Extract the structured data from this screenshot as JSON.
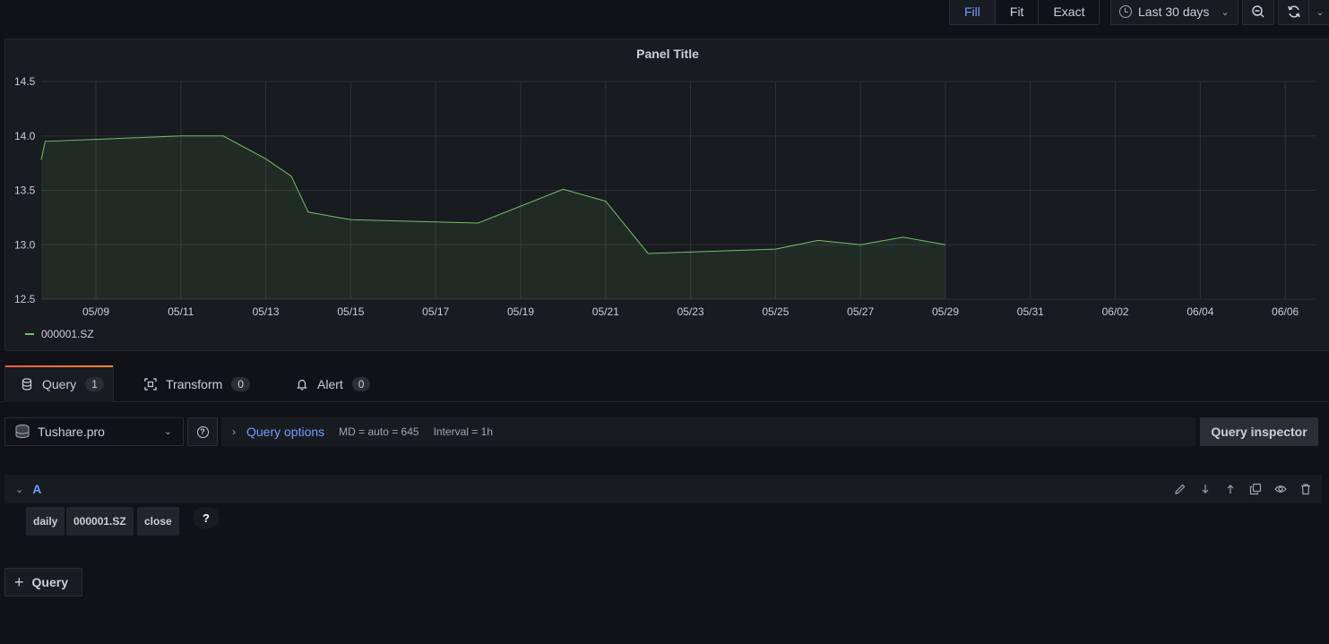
{
  "toolbar": {
    "view_modes": [
      "Fill",
      "Fit",
      "Exact"
    ],
    "active_view_mode": "Fill",
    "time_range": "Last 30 days",
    "icons": {
      "time": "clock-icon",
      "zoom": "zoom-out-icon",
      "refresh": "refresh-icon",
      "dropdown": "chevron-down-icon"
    }
  },
  "panel": {
    "title": "Panel Title"
  },
  "chart_data": {
    "type": "area",
    "title": "Panel Title",
    "y_tick_labels": [
      "12.5",
      "13.0",
      "13.5",
      "14.0",
      "14.5"
    ],
    "ylim": [
      12.5,
      14.5
    ],
    "x_tick_labels": [
      "05/09",
      "05/11",
      "05/13",
      "05/15",
      "05/17",
      "05/19",
      "05/21",
      "05/23",
      "05/25",
      "05/27",
      "05/29",
      "05/31",
      "06/02",
      "06/04",
      "06/06"
    ],
    "grid": true,
    "legend_position": "bottom-left",
    "series": [
      {
        "name": "000001.SZ",
        "color": "#73bf69",
        "points": [
          {
            "x": "05/08",
            "y": 13.78
          },
          {
            "x": "05/08",
            "y": 13.95
          },
          {
            "x": "05/11",
            "y": 14.0
          },
          {
            "x": "05/12",
            "y": 14.0
          },
          {
            "x": "05/13",
            "y": 13.79
          },
          {
            "x": "05/13",
            "y": 13.63
          },
          {
            "x": "05/14",
            "y": 13.3
          },
          {
            "x": "05/15",
            "y": 13.23
          },
          {
            "x": "05/18",
            "y": 13.2
          },
          {
            "x": "05/20",
            "y": 13.51
          },
          {
            "x": "05/21",
            "y": 13.4
          },
          {
            "x": "05/22",
            "y": 12.92
          },
          {
            "x": "05/25",
            "y": 12.96
          },
          {
            "x": "05/26",
            "y": 13.04
          },
          {
            "x": "05/27",
            "y": 13.0
          },
          {
            "x": "05/28",
            "y": 13.07
          },
          {
            "x": "05/29",
            "y": 13.0
          }
        ]
      }
    ]
  },
  "tabs": [
    {
      "label": "Query",
      "count": "1",
      "icon": "database-icon",
      "active": true
    },
    {
      "label": "Transform",
      "count": "0",
      "icon": "transform-icon",
      "active": false
    },
    {
      "label": "Alert",
      "count": "0",
      "icon": "bell-icon",
      "active": false
    }
  ],
  "query_editor": {
    "datasource": "Tushare.pro",
    "query_options_label": "Query options",
    "md_info": "MD = auto = 645",
    "interval_info": "Interval = 1h",
    "inspector_label": "Query inspector",
    "query_a": {
      "ref_id": "A",
      "segments": [
        "daily",
        "000001.SZ",
        "close"
      ],
      "help": "?"
    },
    "add_query_label": "Query"
  }
}
